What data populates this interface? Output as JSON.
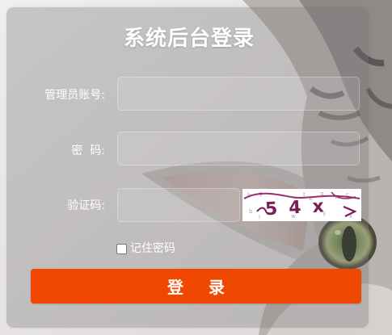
{
  "form": {
    "title": "系统后台登录",
    "username_label": "管理员账号:",
    "username_value": "",
    "username_placeholder": "",
    "password_label": "密  码:",
    "password_value": "",
    "password_placeholder": "",
    "captcha_label": "验证码:",
    "captcha_value": "",
    "captcha_placeholder": "",
    "captcha_image_text": "54x",
    "remember_label": "记住密码",
    "remember_checked": false,
    "submit_label": "登 录"
  },
  "colors": {
    "accent": "#f04800",
    "panel_tint": "#787474",
    "text": "#ffffff",
    "captcha_ink": "#9b2b6b"
  }
}
